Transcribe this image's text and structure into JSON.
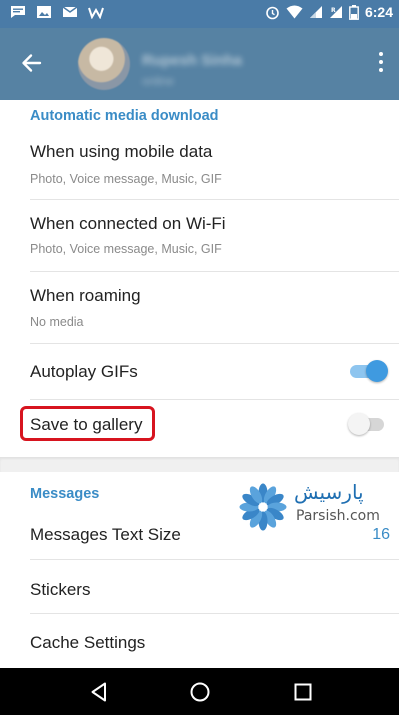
{
  "status_bar": {
    "time": "6:24",
    "icons": [
      "chat-notification-icon",
      "image-notification-icon",
      "mail-icon",
      "w-app-icon",
      "alarm-icon",
      "wifi-icon",
      "signal-icon",
      "roaming-signal-icon",
      "battery-icon"
    ]
  },
  "toolbar": {
    "back_icon": "back-arrow-icon",
    "profile_name": "Rupesh Sinha",
    "profile_status": "online",
    "menu_icon": "more-vert-icon"
  },
  "media_section": {
    "header": "Automatic media download",
    "items": [
      {
        "title": "When using mobile data",
        "subtitle": "Photo, Voice message, Music, GIF"
      },
      {
        "title": "When connected on Wi-Fi",
        "subtitle": "Photo, Voice message, Music, GIF"
      },
      {
        "title": "When roaming",
        "subtitle": "No media"
      }
    ],
    "autoplay_gifs": {
      "label": "Autoplay GIFs",
      "enabled": true
    },
    "save_to_gallery": {
      "label": "Save to gallery",
      "enabled": false
    }
  },
  "messages_section": {
    "header": "Messages",
    "text_size": {
      "label": "Messages Text Size",
      "value": "16"
    },
    "stickers": {
      "label": "Stickers"
    },
    "cache": {
      "label": "Cache Settings"
    }
  },
  "watermark": {
    "persian": "پارسیش",
    "latin": "Parsish.com"
  },
  "nav_bar": {
    "icons": [
      "back-triangle-icon",
      "home-circle-icon",
      "recents-square-icon"
    ]
  },
  "colors": {
    "status_bar": "#4a7ba7",
    "toolbar": "#5682a3",
    "accent": "#3a8cc6",
    "highlight": "#d7141f"
  }
}
